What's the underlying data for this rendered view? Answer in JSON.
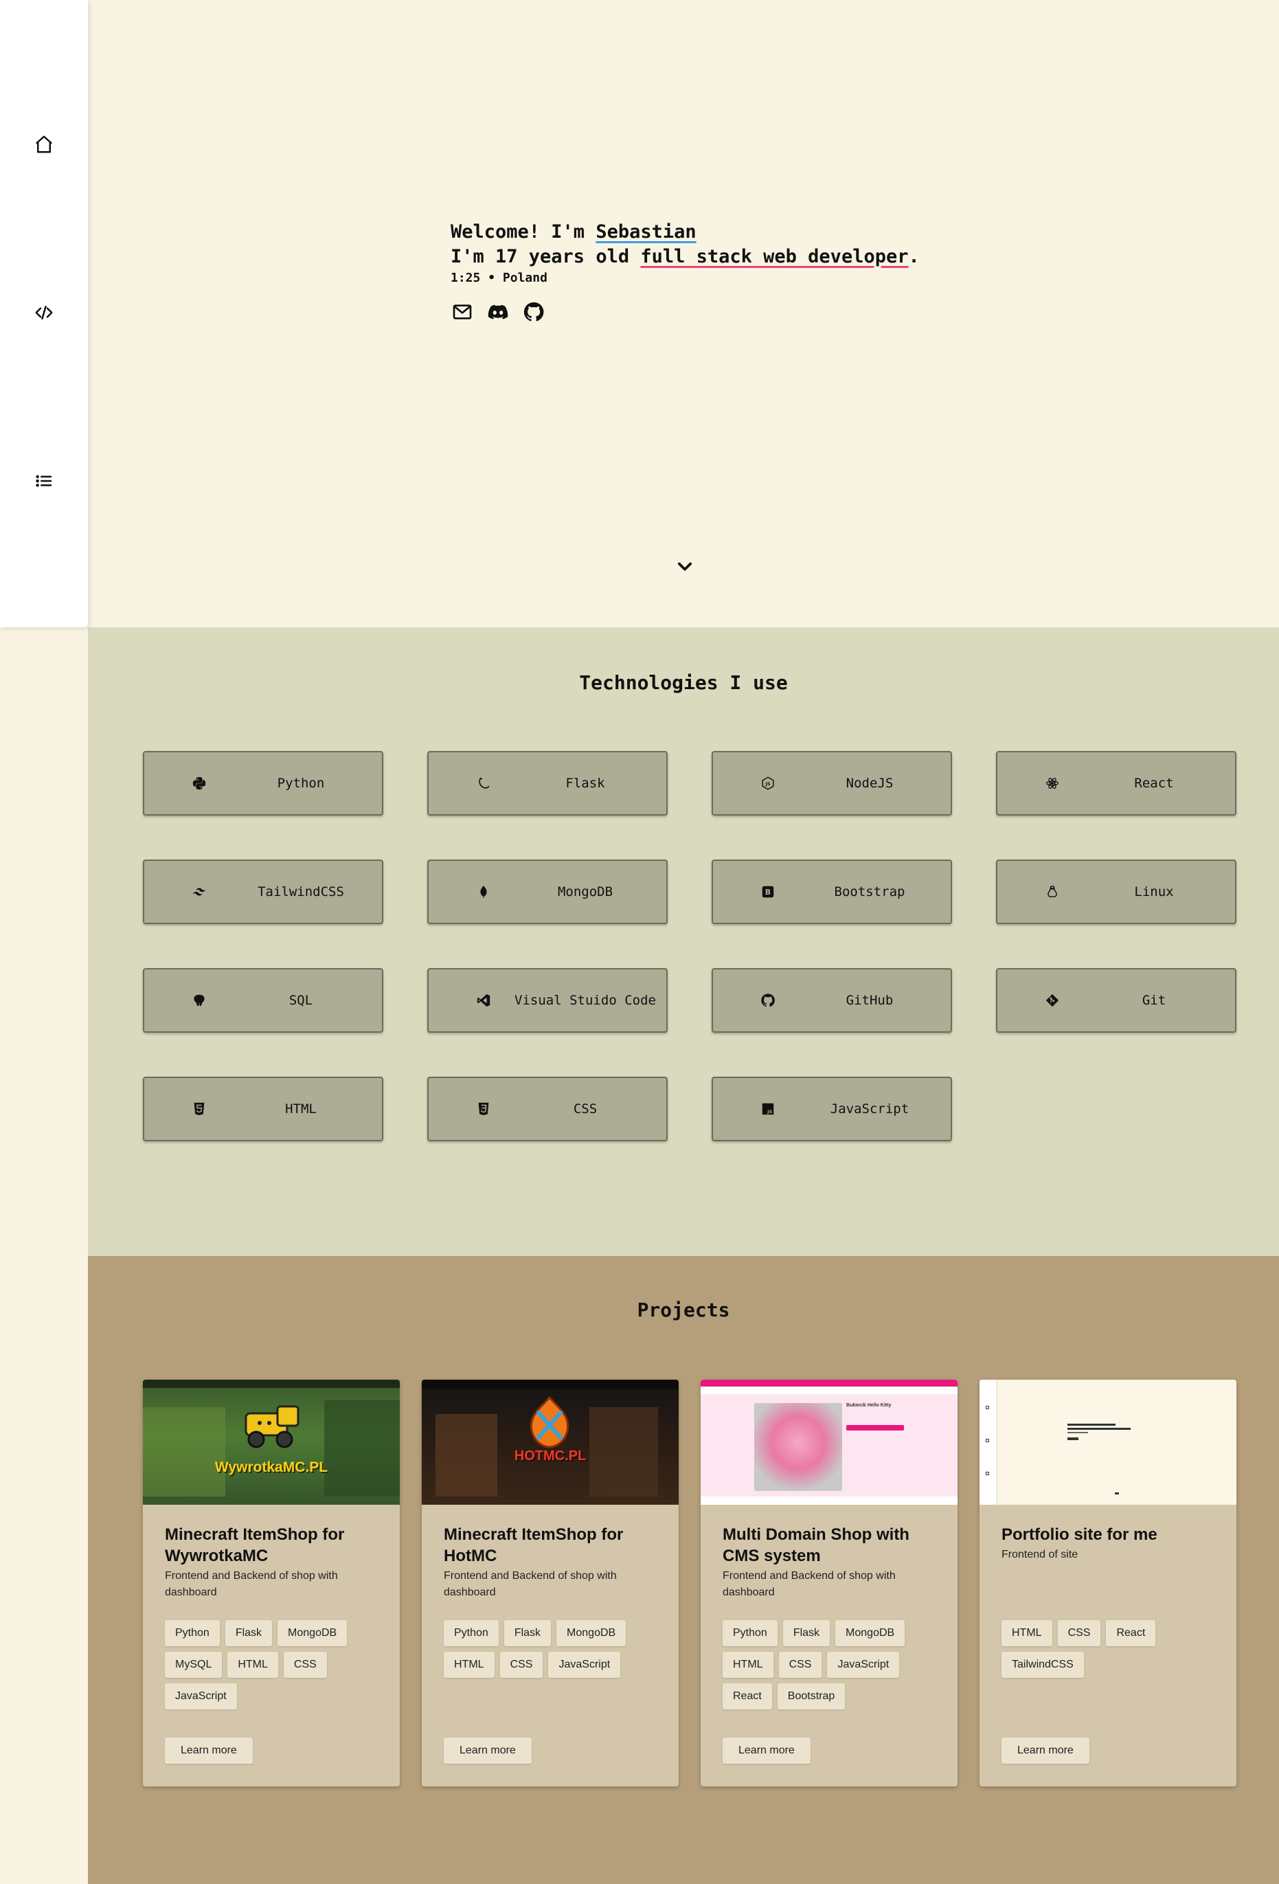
{
  "sidebar": {
    "items": [
      {
        "icon": "home-icon"
      },
      {
        "icon": "code-icon"
      },
      {
        "icon": "list-icon"
      }
    ]
  },
  "hero": {
    "welcome_prefix": "Welcome! I'm ",
    "name": "Sebastian",
    "line2_prefix": "I'm 17 years old ",
    "role": "full stack web developer",
    "line2_suffix": ".",
    "time": "1:25",
    "separator": "•",
    "location": "Poland",
    "social": [
      "mail-icon",
      "discord-icon",
      "github-icon"
    ]
  },
  "technologies": {
    "title": "Technologies I use",
    "items": [
      {
        "label": "Python",
        "icon": "python-icon"
      },
      {
        "label": "Flask",
        "icon": "flask-icon"
      },
      {
        "label": "NodeJS",
        "icon": "nodejs-icon"
      },
      {
        "label": "React",
        "icon": "react-icon"
      },
      {
        "label": "TailwindCSS",
        "icon": "tailwind-icon"
      },
      {
        "label": "MongoDB",
        "icon": "mongodb-icon"
      },
      {
        "label": "Bootstrap",
        "icon": "bootstrap-icon"
      },
      {
        "label": "Linux",
        "icon": "linux-icon"
      },
      {
        "label": "SQL",
        "icon": "sql-icon"
      },
      {
        "label": "Visual Stuido Code",
        "icon": "vscode-icon"
      },
      {
        "label": "GitHub",
        "icon": "github-icon"
      },
      {
        "label": "Git",
        "icon": "git-icon"
      },
      {
        "label": "HTML",
        "icon": "html-icon"
      },
      {
        "label": "CSS",
        "icon": "css-icon"
      },
      {
        "label": "JavaScript",
        "icon": "javascript-icon"
      }
    ]
  },
  "projects": {
    "title": "Projects",
    "learn_more": "Learn more",
    "items": [
      {
        "title": "Minecraft ItemShop for WywrotkaMC",
        "description": "Frontend and Backend of shop with dashboard",
        "thumb_text": "WywrotkaMC.PL",
        "tags": [
          "Python",
          "Flask",
          "MongoDB",
          "MySQL",
          "HTML",
          "CSS",
          "JavaScript"
        ]
      },
      {
        "title": "Minecraft ItemShop for HotMC",
        "description": "Frontend and Backend of shop with dashboard",
        "thumb_text": "HOTMC.PL",
        "tags": [
          "Python",
          "Flask",
          "MongoDB",
          "HTML",
          "CSS",
          "JavaScript"
        ]
      },
      {
        "title": "Multi Domain Shop with CMS system",
        "description": "Frontend and Backend of shop with dashboard",
        "thumb_text": "Bukiecik Hello Kitty",
        "tags": [
          "Python",
          "Flask",
          "MongoDB",
          "HTML",
          "CSS",
          "JavaScript",
          "React",
          "Bootstrap"
        ]
      },
      {
        "title": "Portfolio site for me",
        "description": "Frontend of site",
        "thumb_text": "",
        "tags": [
          "HTML",
          "CSS",
          "React",
          "TailwindCSS"
        ]
      }
    ]
  },
  "colors": {
    "hero_bg": "#f9f4e2",
    "tech_bg": "#d9dabe",
    "tech_button": "#adad96",
    "projects_bg": "#b59f7a",
    "card_bg": "#d4c6ab",
    "name_underline": "#3a9ce8",
    "role_underline": "#e8457c"
  }
}
